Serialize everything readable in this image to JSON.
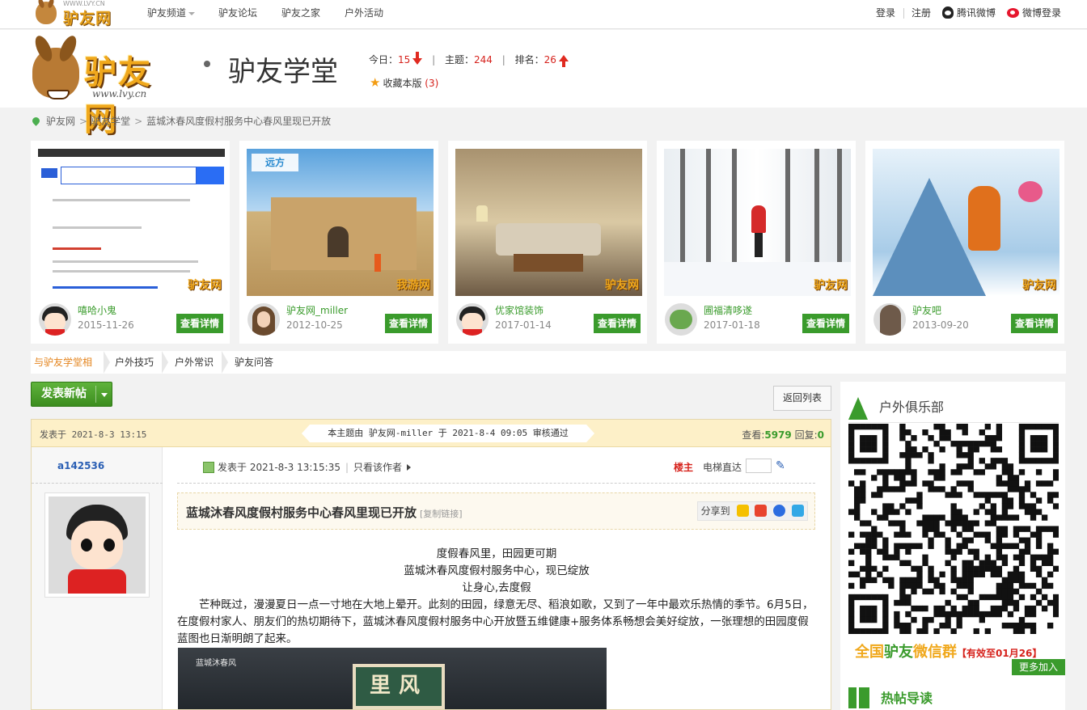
{
  "top_bar": {
    "logo_url": "WWW.LVY.CN",
    "logo_text": "驴友网",
    "nav": [
      {
        "label": "驴友频道",
        "has_dropdown": true
      },
      {
        "label": "驴友论坛",
        "has_dropdown": false
      },
      {
        "label": "驴友之家",
        "has_dropdown": false
      },
      {
        "label": "户外活动",
        "has_dropdown": false
      }
    ],
    "login": "登录",
    "register": "注册",
    "qq_weibo": "腾讯微博",
    "weibo_login": "微博登录"
  },
  "header": {
    "logo_text": "驴友网",
    "logo_url": "www.lvy.cn",
    "forum_name": "驴友学堂",
    "today_label": "今日：",
    "today_value": "15",
    "topics_label": "主题：",
    "topics_value": "244",
    "rank_label": "排名：",
    "rank_value": "26",
    "favorite_label": "收藏本版",
    "favorite_count": "(3)"
  },
  "breadcrumb": [
    "驴友网",
    "驴友学堂",
    "蓝城沐春风度假村服务中心春风里现已开放"
  ],
  "recommend": [
    {
      "author": "嘻哈小鬼",
      "date": "2015-11-26",
      "button": "查看详情",
      "watermark": "驴友网"
    },
    {
      "author": "驴友网_miller",
      "date": "2012-10-25",
      "button": "查看详情",
      "watermark": "我游网",
      "brand": "远方"
    },
    {
      "author": "优家馆装饰",
      "date": "2017-01-14",
      "button": "查看详情",
      "watermark": "驴友网"
    },
    {
      "author": "圃福清哆遂",
      "date": "2017-01-18",
      "button": "查看详情",
      "watermark": "驴友网"
    },
    {
      "author": "驴友吧",
      "date": "2013-09-20",
      "button": "查看详情",
      "watermark": "驴友网"
    }
  ],
  "subnav": [
    "与驴友学堂相",
    "户外技巧",
    "户外常识",
    "驴友问答"
  ],
  "actions": {
    "new_post": "发表新帖",
    "back_list": "返回列表"
  },
  "thread": {
    "posted": "发表于 2021-8-3 13:15",
    "review_notice": "本主题由 驴友网-miller 于 2021-8-4 09:05 审核通过",
    "views_label": "查看:",
    "views": "5979",
    "replies_label": "回复:",
    "replies": "0",
    "username": "a142536",
    "post_time": "发表于 2021-8-3 13:15:35",
    "author_only": "只看该作者",
    "floor": "楼主",
    "elevator": "电梯直达",
    "title": "蓝城沐春风度假村服务中心春风里现已开放",
    "copy_link": "[复制链接]",
    "share": "分享到",
    "body": [
      "度假春风里，田园更可期",
      "蓝城沐春风度假村服务中心，现已绽放",
      "让身心,去度假",
      "芒种既过，漫漫夏日一点一寸地在大地上晕开。此刻的田园，绿意无尽、稻浪如歌，又到了一年中最欢乐热情的季节。6月5日，在度假村家人、朋友们的热切期待下，蓝城沐春风度假村服务中心开放暨五维健康+服务体系畅想会美好绽放，一张理想的田园度假蓝图也日渐明朗了起来。"
    ],
    "image_brand": "蓝城沐春风",
    "image_sign": "里风春"
  },
  "sidebar": {
    "club_title": "户外俱乐部",
    "wechat_prefix": "全国",
    "wechat_highlight": "驴友",
    "wechat_suffix": "微信群",
    "wechat_valid": "【有效至01月26】",
    "more_join": "更多加入",
    "hot_title": "热帖导读"
  },
  "colors": {
    "accent_green": "#3a9b2c",
    "stat_red": "#d6221c",
    "logo_gold": "#f0a81c",
    "thread_header": "#fdf0c8"
  }
}
